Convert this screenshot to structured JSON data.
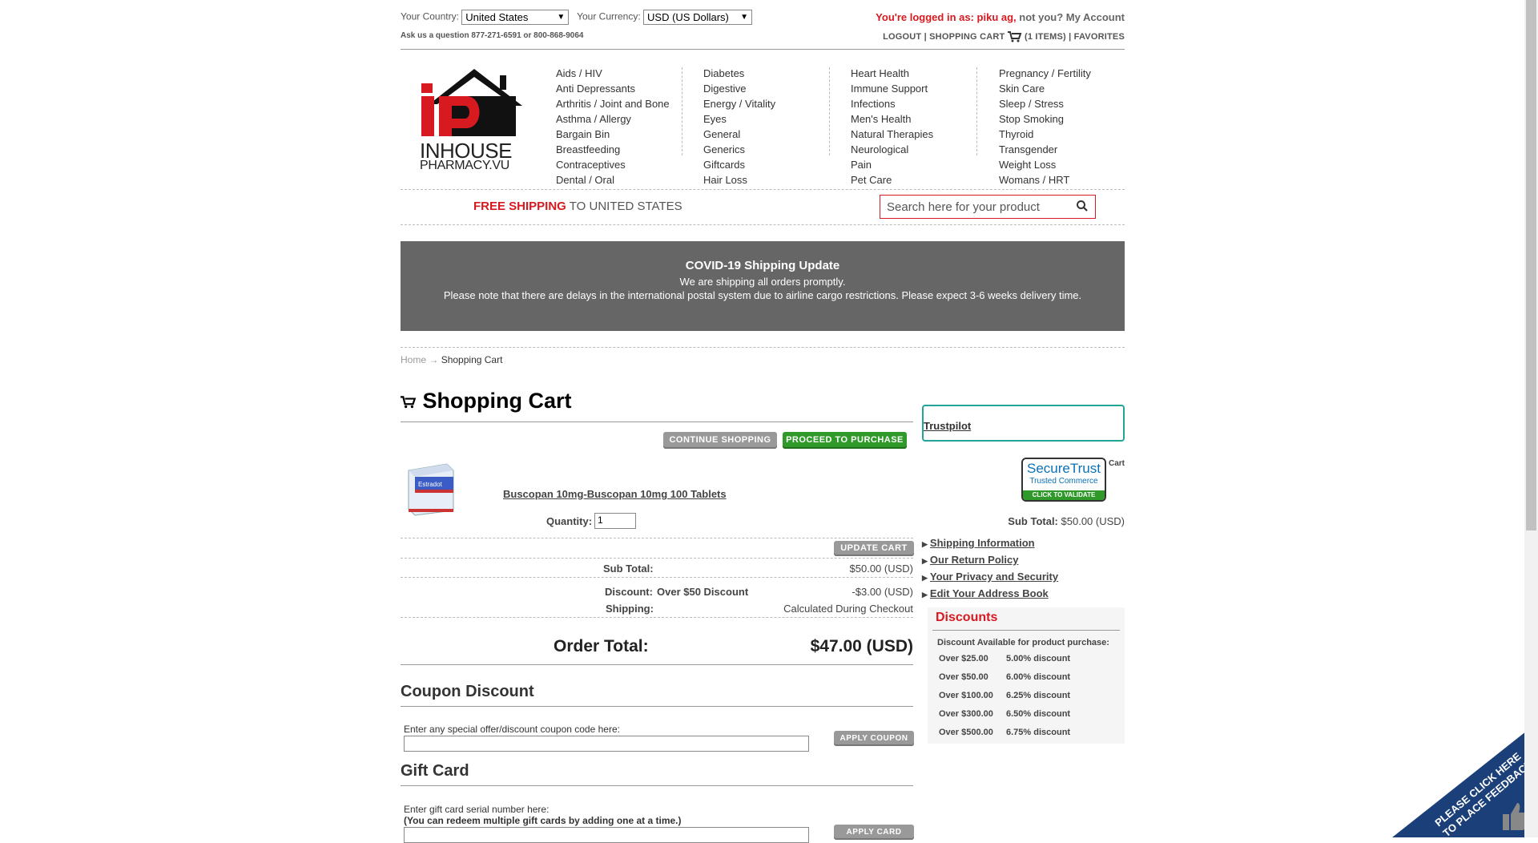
{
  "topbar": {
    "country_label": "Your Country:",
    "country_value": "United States",
    "currency_label": "Your Currency:",
    "currency_value": "USD (US Dollars)",
    "login_prefix": "You're logged in as: piku ag,",
    "login_notyou": "not you?",
    "login_account": "My Account",
    "ask": "Ask us a question 877-271-6591 or 800-868-9064",
    "logout": "LOGOUT",
    "shopping_cart": "SHOPPING CART",
    "items": "(1 ITEMS)",
    "favorites": "FAVORITES"
  },
  "logo": {
    "line1": "INHOUSE",
    "line2": "PHARMACY.VU"
  },
  "categories": {
    "col1": [
      "Aids / HIV",
      "Anti Depressants",
      "Arthritis / Joint and Bone",
      "Asthma / Allergy",
      "Bargain Bin",
      "Breastfeeding",
      "Contraceptives",
      "Dental / Oral"
    ],
    "col2": [
      "Diabetes",
      "Digestive",
      "Energy / Vitality",
      "Eyes",
      "General",
      "Generics",
      "Giftcards",
      "Hair Loss"
    ],
    "col3": [
      "Heart Health",
      "Immune Support",
      "Infections",
      "Men's Health",
      "Natural Therapies",
      "Neurological",
      "Pain",
      "Pet Care"
    ],
    "col4": [
      "Pregnancy / Fertility",
      "Skin Care",
      "Sleep / Stress",
      "Stop Smoking",
      "Thyroid",
      "Transgender",
      "Weight Loss",
      "Womans / HRT"
    ]
  },
  "shipping": {
    "free": "FREE SHIPPING",
    "rest": "TO UNITED STATES"
  },
  "search": {
    "placeholder": "Search here for your product"
  },
  "covid": {
    "title": "COVID-19 Shipping Update",
    "line1": "We are shipping all orders promptly.",
    "line2": "Please note that there are delays in the international postal system due to airline cargo restrictions. Please expect 3-6 weeks delivery time."
  },
  "breadcrumb": {
    "home": "Home",
    "arrow": "→",
    "current": "Shopping Cart"
  },
  "cart": {
    "title": "Shopping Cart",
    "continue": "CONTINUE SHOPPING",
    "proceed": "PROCEED TO PURCHASE",
    "remove": "Remove from Cart",
    "product_name": "Buscopan 10mg-Buscopan 10mg 100 Tablets",
    "product_box_label": "Estradot",
    "quantity_label": "Quantity:",
    "quantity_value": "1",
    "subtotal_label_inline": "Sub Total:",
    "subtotal_value_inline": "$50.00 (USD)",
    "update": "UPDATE CART",
    "subtotal_label": "Sub Total:",
    "subtotal_value": "$50.00 (USD)",
    "discount_label": "Discount:",
    "discount_name": "Over $50 Discount",
    "discount_value": "-$3.00 (USD)",
    "shipping_label": "Shipping:",
    "shipping_value": "Calculated During Checkout",
    "order_total_label": "Order Total:",
    "order_total_value": "$47.00 (USD)"
  },
  "coupon": {
    "title": "Coupon Discount",
    "label": "Enter any special offer/discount coupon code here:",
    "apply": "APPLY COUPON"
  },
  "giftcard": {
    "title": "Gift Card",
    "label1": "Enter gift card serial number here:",
    "label2": "(You can redeem multiple gift cards by adding one at a time.)",
    "apply": "APPLY CARD"
  },
  "sidebar": {
    "trustpilot": "Trustpilot",
    "securetrust": {
      "line1": "SecureTrust",
      "line2": "Trusted Commerce",
      "line3": "CLICK TO VALIDATE"
    },
    "links": [
      "Shipping Information",
      "Our Return Policy",
      "Your Privacy and Security",
      "Edit Your Address Book"
    ],
    "discounts_title": "Discounts",
    "discounts_intro": "Discount Available for product purchase:",
    "discounts": [
      {
        "over": "Over $25.00",
        "pct": "5.00% discount"
      },
      {
        "over": "Over $50.00",
        "pct": "6.00% discount"
      },
      {
        "over": "Over $100.00",
        "pct": "6.25% discount"
      },
      {
        "over": "Over $300.00",
        "pct": "6.50% discount"
      },
      {
        "over": "Over $500.00",
        "pct": "6.75% discount"
      }
    ]
  },
  "feedback": {
    "line1": "PLEASE CLICK HERE",
    "line2": "TO PLACE FEEDBACK"
  },
  "colors": {
    "accent_red": "#d71920",
    "green_button": "#2f9a29",
    "banner_grey": "#666666",
    "trustpilot_border": "#22a594"
  }
}
